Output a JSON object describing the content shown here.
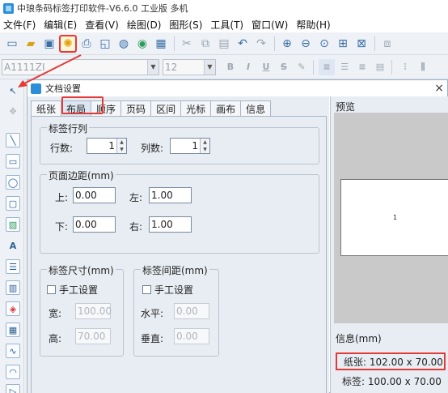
{
  "app": {
    "title": "中琅条码标签打印软件-V6.6.0 工业版 多机"
  },
  "menu": [
    "文件(F)",
    "编辑(E)",
    "查看(V)",
    "绘图(D)",
    "图形(S)",
    "工具(T)",
    "窗口(W)",
    "帮助(H)"
  ],
  "toolbar2": {
    "font_name": "A1111ZI",
    "font_size": "12"
  },
  "dialog": {
    "title": "文档设置",
    "tabs": [
      "纸张",
      "布局",
      "顺序",
      "页码",
      "区间",
      "光标",
      "画布",
      "信息"
    ],
    "label_rowcol": {
      "title": "标签行列",
      "rows_label": "行数:",
      "rows_value": "1",
      "cols_label": "列数:",
      "cols_value": "1"
    },
    "margins": {
      "title": "页面边距(mm)",
      "top_label": "上:",
      "top_value": "0.00",
      "left_label": "左:",
      "left_value": "1.00",
      "bottom_label": "下:",
      "bottom_value": "0.00",
      "right_label": "右:",
      "right_value": "1.00"
    },
    "label_size": {
      "title": "标签尺寸(mm)",
      "manual_label": "手工设置",
      "width_label": "宽:",
      "width_value": "100.00",
      "height_label": "高:",
      "height_value": "70.00"
    },
    "label_spacing": {
      "title": "标签间距(mm)",
      "manual_label": "手工设置",
      "h_label": "水平:",
      "h_value": "0.00",
      "v_label": "垂直:",
      "v_value": "0.00"
    },
    "preview": {
      "title": "预览",
      "page_number": "1"
    },
    "info": {
      "title": "信息(mm)",
      "paper": "纸张: 102.00 x 70.00",
      "label": "标签: 100.00 x 70.00"
    },
    "close": "×"
  }
}
